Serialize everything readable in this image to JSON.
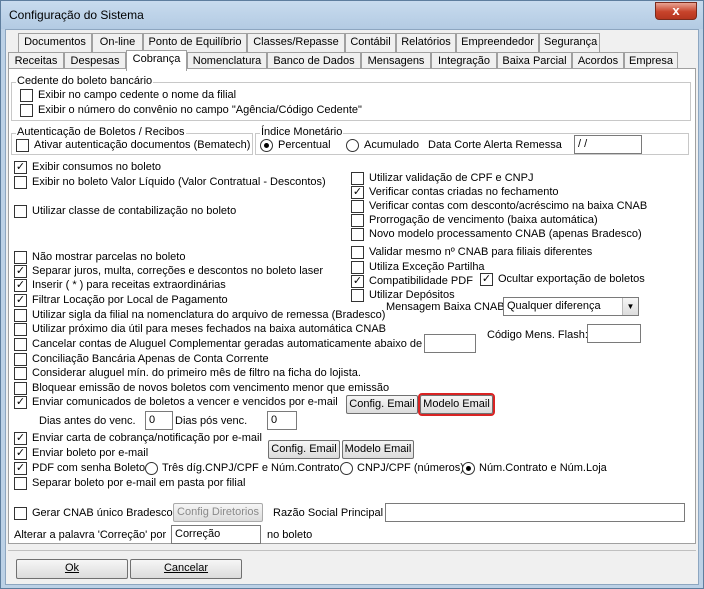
{
  "window": {
    "title": "Configuração do Sistema",
    "close_label": "x"
  },
  "tabs_row1": [
    "Documentos",
    "On-line",
    "Ponto de Equilíbrio",
    "Classes/Repasse",
    "Contábil",
    "Relatórios",
    "Empreendedor",
    "Segurança"
  ],
  "tabs_row2": [
    "Receitas",
    "Despesas",
    "Cobrança",
    "Nomenclatura",
    "Banco de Dados",
    "Mensagens",
    "Integração",
    "Baixa Parcial",
    "Acordos",
    "Empresa"
  ],
  "active_tab": "Cobrança",
  "cedente": {
    "title": "Cedente do boleto bancário",
    "opt1": "Exibir no campo cedente o nome da filial",
    "opt2": "Exibir o número do convênio no campo \"Agência/Código Cedente\""
  },
  "autenticacao": {
    "title": "Autenticação de Boletos / Recibos",
    "opt1": "Ativar autenticação documentos (Bematech)"
  },
  "indice": {
    "title": "Índice Monetário",
    "percentual": "Percentual",
    "acumulado": "Acumulado"
  },
  "data_corte": {
    "label": "Data Corte Alerta Remessa",
    "value": " /  /"
  },
  "left_opts": {
    "exibir_consumos": "Exibir consumos no boleto",
    "valor_liquido": "Exibir no boleto Valor Líquido (Valor Contratual - Descontos)",
    "classe_contab": "Utilizar classe de contabilização no boleto",
    "nao_mostrar_parcelas": "Não mostrar parcelas no boleto",
    "separar_juros": "Separar juros, multa, correções e descontos no boleto laser",
    "inserir": "Inserir ( * ) para receitas extraordinárias",
    "filtrar_locacao": "Filtrar Locação por Local de Pagamento",
    "sigla_filial": "Utilizar sigla da filial na nomenclatura do arquivo de remessa (Bradesco)",
    "proximo_dia": "Utilizar próximo dia útil para meses fechados na baixa automática CNAB",
    "cancelar_contas": "Cancelar contas de Aluguel Complementar geradas automaticamente abaixo de R$",
    "conciliacao": "Conciliação Bancária Apenas de Conta Corrente",
    "considerar_aluguel": "Considerar aluguel mín. do primeiro mês de filtro na ficha do lojista.",
    "bloquear_emissao": "Bloquear emissão de novos boletos com vencimento menor que emissão",
    "enviar_comunicados": "Enviar comunicados de boletos a vencer e vencidos por e-mail"
  },
  "right_opts": {
    "validacao_cpf": "Utilizar validação de CPF e CNPJ",
    "verificar_criadas": "Verificar contas criadas no fechamento",
    "verificar_desconto": "Verificar contas com desconto/acréscimo na baixa CNAB",
    "prorrogacao": "Prorrogação de vencimento (baixa automática)",
    "novo_modelo": "Novo modelo processamento CNAB (apenas Bradesco)",
    "validar_cnab": "Validar mesmo nº CNAB para filiais diferentes",
    "excecao_partilha": "Utiliza Exceção Partilha",
    "compat_pdf": "Compatibilidade PDF",
    "ocultar_exportacao": "Ocultar exportação de boletos",
    "utilizar_depositos": "Utilizar Depósitos"
  },
  "mensagem_baixa": {
    "label": "Mensagem Baixa CNAB:",
    "value": "Qualquer diferença"
  },
  "codigo_flash": {
    "label": "Código Mens. Flash:",
    "value": ""
  },
  "cancelar_valor": "",
  "buttons": {
    "config_email": "Config. Email",
    "modelo_email": "Modelo Email",
    "config_email2": "Config. Email",
    "modelo_email2": "Modelo Email",
    "config_diretorios": "Config Diretorios",
    "ok": "Ok",
    "cancelar": "Cancelar"
  },
  "dias": {
    "antes_label": "Dias antes do venc.",
    "antes_value": "0",
    "pos_label": "Dias pós venc.",
    "pos_value": "0"
  },
  "email_opts": {
    "carta_cobranca": "Enviar carta de cobrança/notificação por e-mail",
    "boleto_email": "Enviar boleto por e-mail",
    "pdf_senha": "PDF com senha Boleto",
    "tres_dig": "Três díg.CNPJ/CPF e Núm.Contrato",
    "cnpj_numeros": "CNPJ/CPF (números)",
    "num_contrato": "Núm.Contrato e Núm.Loja",
    "separar_boleto": "Separar boleto por e-mail em pasta por filial"
  },
  "cnab_unico": {
    "label": "Gerar CNAB único Bradesco",
    "razao_label": "Razão Social Principal",
    "razao_value": ""
  },
  "correcao": {
    "label": "Alterar a palavra 'Correção' por",
    "value": "Correção",
    "suffix": "no boleto"
  }
}
